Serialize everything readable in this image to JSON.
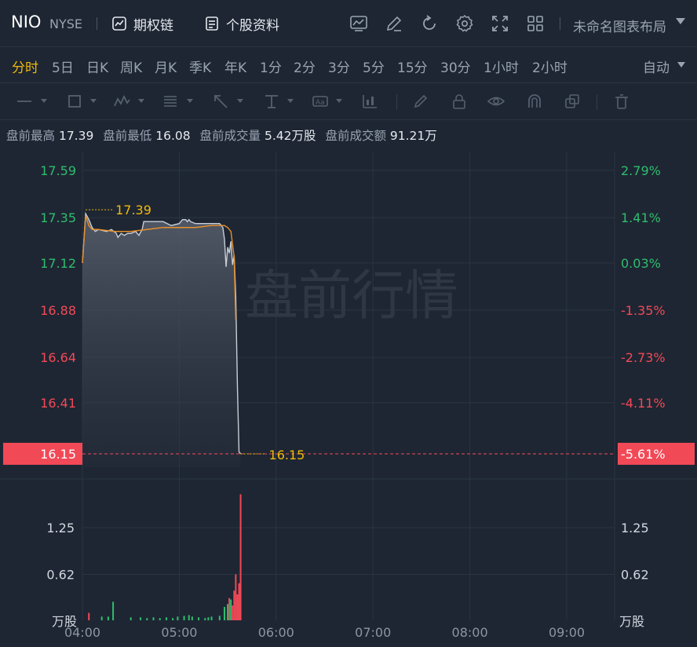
{
  "header": {
    "ticker": "NIO",
    "exchange": "NYSE",
    "options_chain_label": "期权链",
    "stock_profile_label": "个股资料",
    "layout_label": "未命名图表布局",
    "icons": [
      "indicator-icon",
      "draw-edit-icon",
      "refresh-icon",
      "settings-icon",
      "fullscreen-icon",
      "grid-layout-icon"
    ]
  },
  "periods": [
    "分时",
    "5日",
    "日K",
    "周K",
    "月K",
    "季K",
    "年K",
    "1分",
    "2分",
    "3分",
    "5分",
    "15分",
    "30分",
    "1小时",
    "2小时"
  ],
  "active_period": "分时",
  "scale_mode": "自动",
  "drawing_tools": [
    "line-tool-icon",
    "shape-tool-icon",
    "pattern-tool-icon",
    "fibonacci-tool-icon",
    "arrow-tool-icon",
    "measure-tool-icon",
    "text-tool-icon",
    "bars-tool-icon",
    "brush-icon",
    "lock-icon",
    "eye-icon",
    "magnet-icon",
    "copy-icon",
    "trash-icon"
  ],
  "info": {
    "high_label": "盘前最高",
    "high_value": "17.39",
    "low_label": "盘前最低",
    "low_value": "16.08",
    "volume_label": "盘前成交量",
    "volume_value": "5.42万股",
    "amount_label": "盘前成交额",
    "amount_value": "91.21万"
  },
  "watermark": "盘前行情",
  "colors": {
    "up": "#2fbd6e",
    "down": "#f24957",
    "avg_line": "#e8902a",
    "price_line": "#c9ced6",
    "marker": "#f0b90b"
  },
  "chart_data": {
    "type": "line",
    "title": "",
    "price_axis_labels": [
      "17.59",
      "17.35",
      "17.12",
      "16.88",
      "16.64",
      "16.41"
    ],
    "percent_axis_labels": [
      "2.79%",
      "1.41%",
      "0.03%",
      "-1.35%",
      "-2.73%",
      "-4.11%"
    ],
    "current_price_label": "16.15",
    "current_percent_label": "-5.61%",
    "high_marker": "17.39",
    "last_marker": "16.15",
    "x_ticks": [
      "04:00",
      "05:00",
      "06:00",
      "07:00",
      "08:00",
      "09:00"
    ],
    "ylim": [
      16.08,
      17.59
    ],
    "price_series": {
      "name": "",
      "x": [
        "04:00",
        "04:02",
        "04:04",
        "04:06",
        "04:08",
        "04:10",
        "04:15",
        "04:18",
        "04:21",
        "04:22",
        "04:24",
        "04:26",
        "04:28",
        "04:30",
        "04:33",
        "04:35",
        "04:37",
        "04:38",
        "04:45",
        "04:50",
        "04:55",
        "05:00",
        "05:02",
        "05:04",
        "05:05",
        "05:06",
        "05:07",
        "05:10",
        "05:15",
        "05:20",
        "05:25",
        "05:27",
        "05:28",
        "05:29",
        "05:30",
        "05:31",
        "05:32",
        "05:33",
        "05:34",
        "05:35",
        "05:36",
        "05:37",
        "05:38"
      ],
      "values": [
        17.12,
        17.37,
        17.34,
        17.3,
        17.28,
        17.29,
        17.28,
        17.29,
        17.27,
        17.25,
        17.27,
        17.26,
        17.27,
        17.27,
        17.28,
        17.26,
        17.29,
        17.33,
        17.33,
        17.33,
        17.31,
        17.32,
        17.34,
        17.34,
        17.33,
        17.34,
        17.33,
        17.32,
        17.32,
        17.32,
        17.32,
        17.3,
        17.24,
        17.1,
        17.2,
        17.17,
        17.23,
        17.11,
        17.16,
        16.95,
        16.5,
        16.16,
        16.15
      ]
    },
    "avg_series": {
      "name": "",
      "x": [
        "04:00",
        "04:02",
        "04:04",
        "04:06",
        "04:10",
        "04:20",
        "04:30",
        "04:40",
        "04:50",
        "05:00",
        "05:10",
        "05:20",
        "05:25",
        "05:28",
        "05:30",
        "05:32",
        "05:34",
        "05:35"
      ],
      "values": [
        17.12,
        17.36,
        17.31,
        17.29,
        17.29,
        17.28,
        17.28,
        17.29,
        17.3,
        17.3,
        17.3,
        17.31,
        17.31,
        17.31,
        17.3,
        17.28,
        17.15,
        16.83
      ]
    },
    "volume_axis_labels": [
      "1.25",
      "0.62"
    ],
    "volume_unit": "万股",
    "volume_ylim": [
      0,
      1.8
    ],
    "volume": {
      "x": [
        "04:04",
        "04:12",
        "04:16",
        "04:19",
        "04:30",
        "04:36",
        "04:40",
        "04:44",
        "04:48",
        "04:52",
        "04:56",
        "04:59",
        "05:03",
        "05:06",
        "05:08",
        "05:12",
        "05:16",
        "05:18",
        "05:20",
        "05:25",
        "05:28",
        "05:30",
        "05:31",
        "05:32",
        "05:33",
        "05:34",
        "05:35",
        "05:36",
        "05:37",
        "05:38"
      ],
      "values": [
        0.1,
        0.05,
        0.05,
        0.25,
        0.04,
        0.04,
        0.03,
        0.04,
        0.03,
        0.04,
        0.03,
        0.05,
        0.06,
        0.07,
        0.05,
        0.04,
        0.03,
        0.04,
        0.05,
        0.06,
        0.18,
        0.22,
        0.3,
        0.28,
        0.2,
        0.4,
        0.62,
        0.35,
        0.5,
        1.7
      ],
      "up": [
        false,
        true,
        true,
        true,
        true,
        true,
        true,
        true,
        true,
        true,
        true,
        true,
        true,
        true,
        true,
        true,
        true,
        true,
        true,
        true,
        true,
        true,
        false,
        true,
        false,
        false,
        false,
        false,
        false,
        false
      ]
    }
  }
}
